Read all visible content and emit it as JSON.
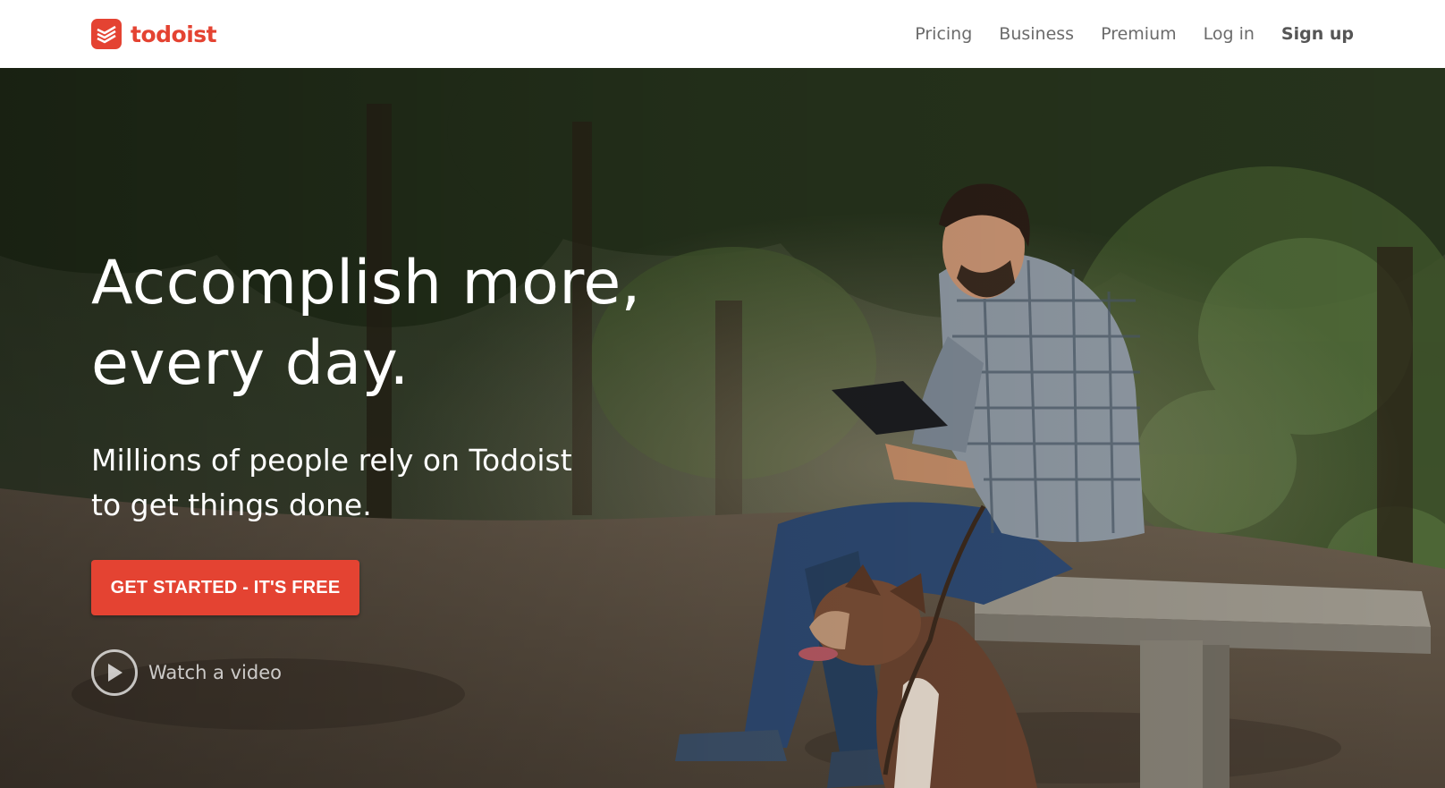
{
  "header": {
    "brand_name": "todoist",
    "nav": [
      {
        "label": "Pricing"
      },
      {
        "label": "Business"
      },
      {
        "label": "Premium"
      },
      {
        "label": "Log in"
      },
      {
        "label": "Sign up"
      }
    ]
  },
  "hero": {
    "headline_line1": "Accomplish more,",
    "headline_line2": "every day.",
    "subtitle_line1": "Millions of people rely on Todoist",
    "subtitle_line2": "to get things done.",
    "cta_label": "GET STARTED - IT'S FREE",
    "video_label": "Watch a video",
    "background_description_icon": "photo-man-with-tablet-and-dog-icon"
  },
  "colors": {
    "brand": "#e44332",
    "nav_text": "#6b6b6b",
    "hero_text": "#ffffff"
  }
}
